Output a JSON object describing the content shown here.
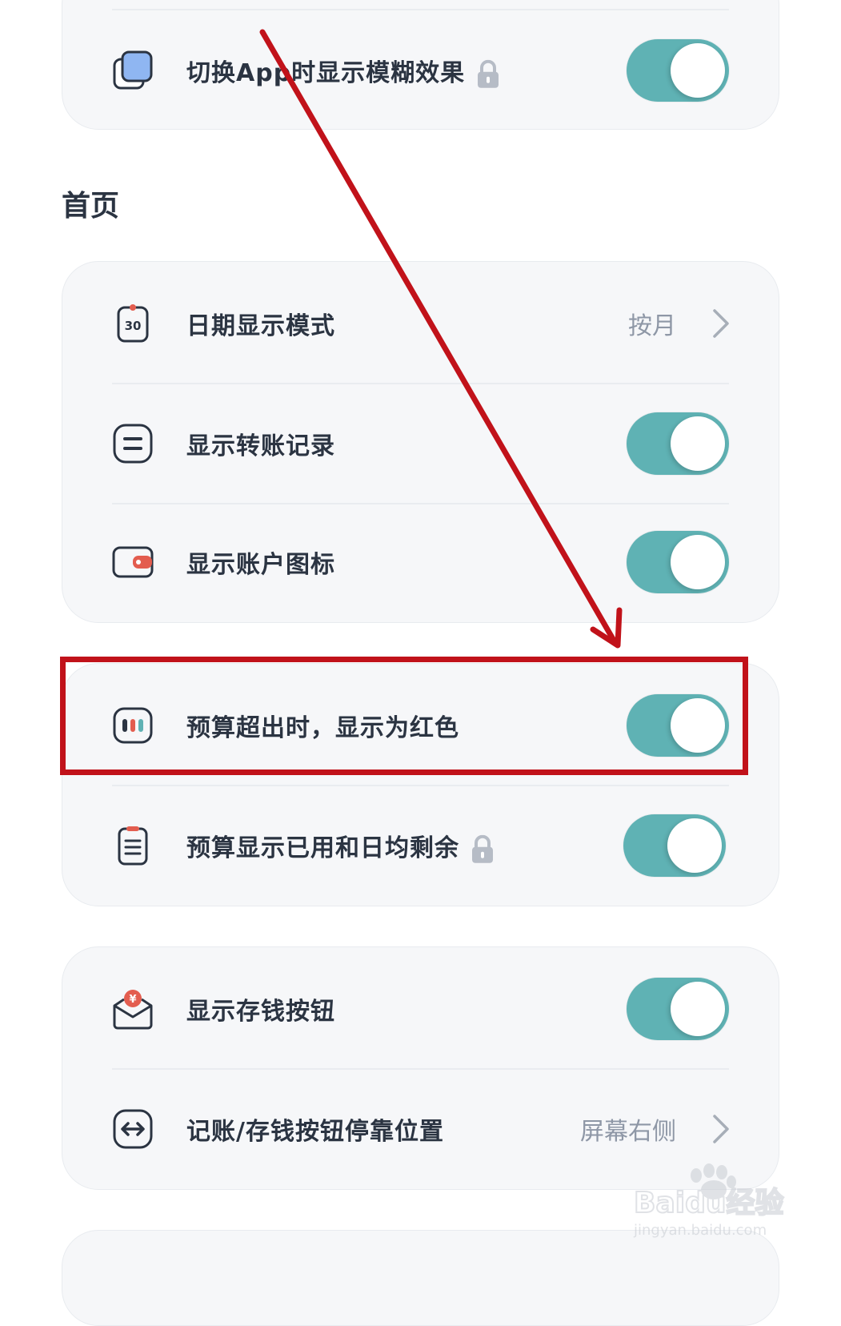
{
  "colors": {
    "toggle_on": "#5fb2b4",
    "highlight": "#c1121a",
    "annotation_arrow": "#c1121a",
    "text": "#2b3442",
    "muted": "#8e97a6"
  },
  "top_card": {
    "rows": [
      {
        "label": "切换App时显示模糊效果",
        "icon": "layers-icon",
        "locked": true,
        "toggle": true
      }
    ]
  },
  "home_section": {
    "title": "首页",
    "card1": {
      "rows": [
        {
          "label": "日期显示模式",
          "icon": "calendar-30-icon",
          "value": "按月",
          "chevron": true
        },
        {
          "label": "显示转账记录",
          "icon": "transfer-icon",
          "toggle": true
        },
        {
          "label": "显示账户图标",
          "icon": "wallet-icon",
          "toggle": true
        }
      ]
    },
    "card2": {
      "rows": [
        {
          "label": "预算超出时，显示为红色",
          "icon": "budget-bars-icon",
          "toggle": true,
          "highlighted": true
        },
        {
          "label": "预算显示已用和日均剩余",
          "icon": "document-icon",
          "locked": true,
          "toggle": true
        }
      ]
    },
    "card3": {
      "rows": [
        {
          "label": "显示存钱按钮",
          "icon": "money-envelope-icon",
          "toggle": true
        },
        {
          "label": "记账/存钱按钮停靠位置",
          "icon": "left-right-arrow-icon",
          "value": "屏幕右侧",
          "chevron": true
        }
      ]
    }
  },
  "watermark": {
    "brand": "Baidu经验",
    "url": "jingyan.baidu.com"
  }
}
